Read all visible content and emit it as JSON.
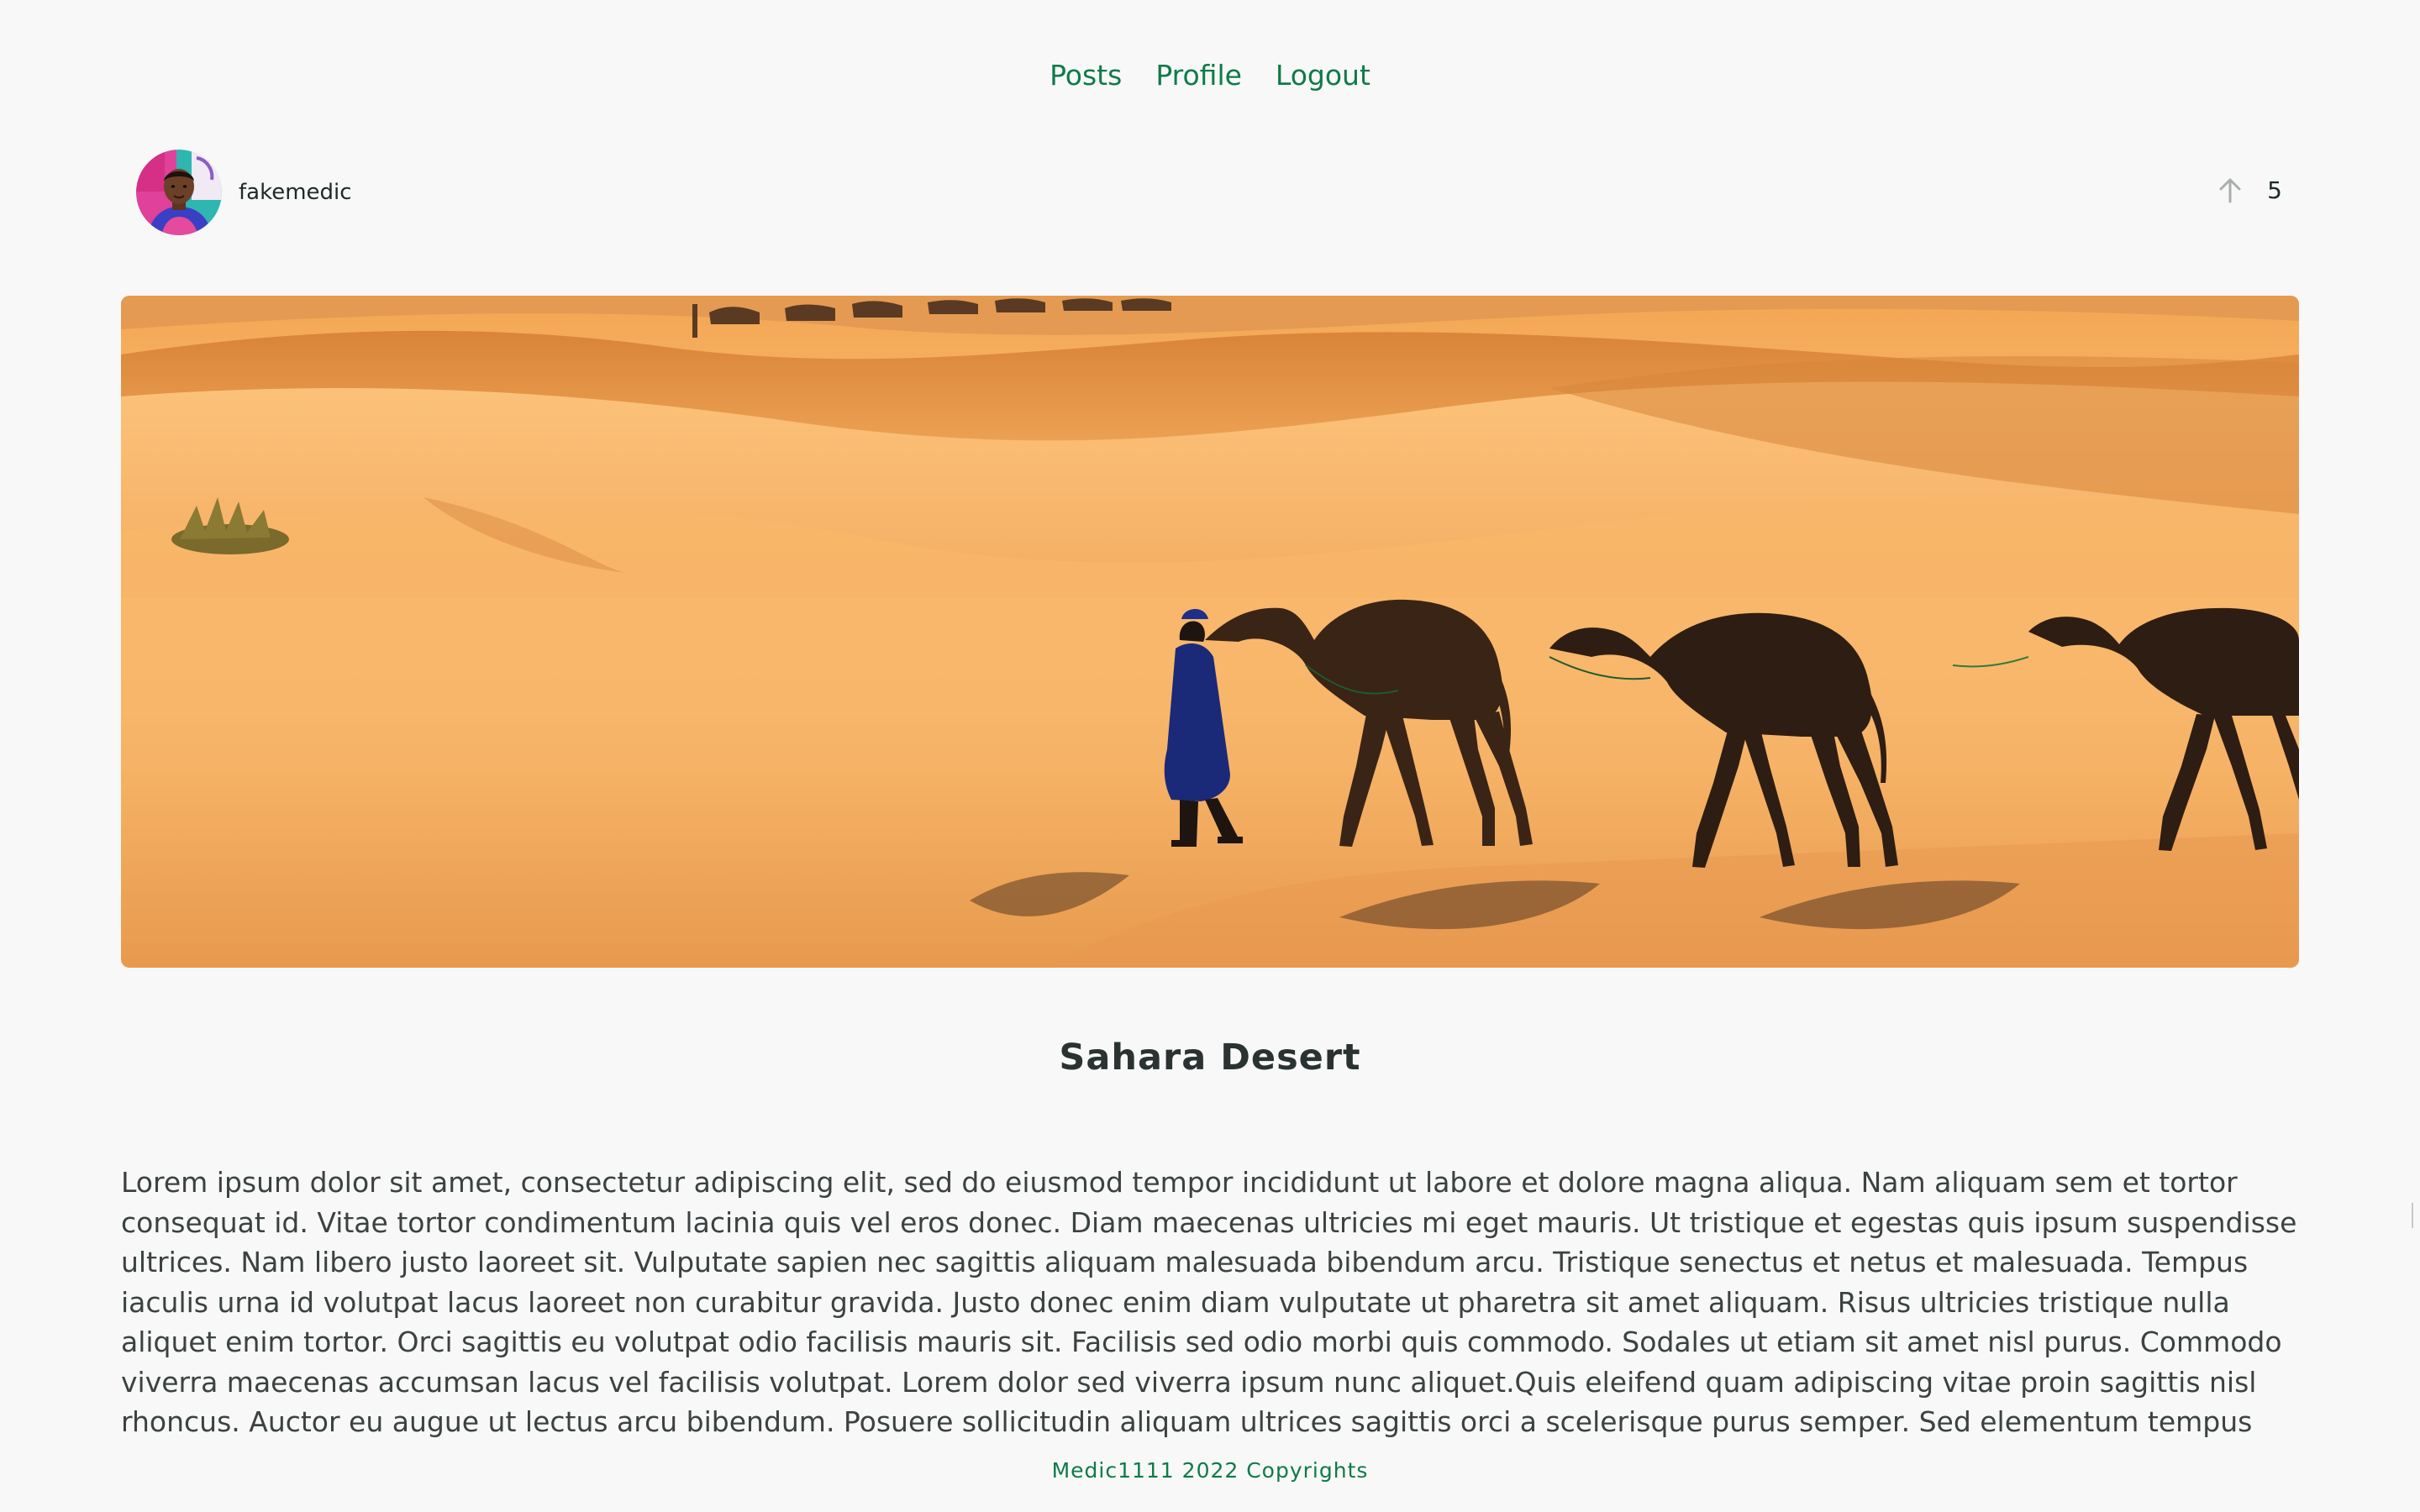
{
  "nav": {
    "items": [
      "Posts",
      "Profile",
      "Logout"
    ]
  },
  "post": {
    "author": "fakemedic",
    "votes": "5",
    "title": "Sahara Desert",
    "body": "Lorem ipsum dolor sit amet, consectetur adipiscing elit, sed do eiusmod tempor incididunt ut labore et dolore magna aliqua. Nam aliquam sem et tortor consequat id. Vitae tortor condimentum lacinia quis vel eros donec. Diam maecenas ultricies mi eget mauris. Ut tristique et egestas quis ipsum suspendisse ultrices. Nam libero justo laoreet sit. Vulputate sapien nec sagittis aliquam malesuada bibendum arcu. Tristique senectus et netus et malesuada. Tempus iaculis urna id volutpat lacus laoreet non curabitur gravida. Justo donec enim diam vulputate ut pharetra sit amet aliquam. Risus ultricies tristique nulla aliquet enim tortor. Orci sagittis eu volutpat odio facilisis mauris sit. Facilisis sed odio morbi quis commodo. Sodales ut etiam sit amet nisl purus. Commodo viverra maecenas accumsan lacus vel facilisis volutpat. Lorem dolor sed viverra ipsum nunc aliquet.Quis eleifend quam adipiscing vitae proin sagittis nisl rhoncus. Auctor eu augue ut lectus arcu bibendum. Posuere sollicitudin aliquam ultrices sagittis orci a scelerisque purus semper. Sed elementum tempus"
  },
  "footer": {
    "text": "Medic1111 2022 Copyrights"
  },
  "theme": {
    "accent": "#0f7a4a",
    "background": "#f8f8f8",
    "text": "#3b4241"
  }
}
